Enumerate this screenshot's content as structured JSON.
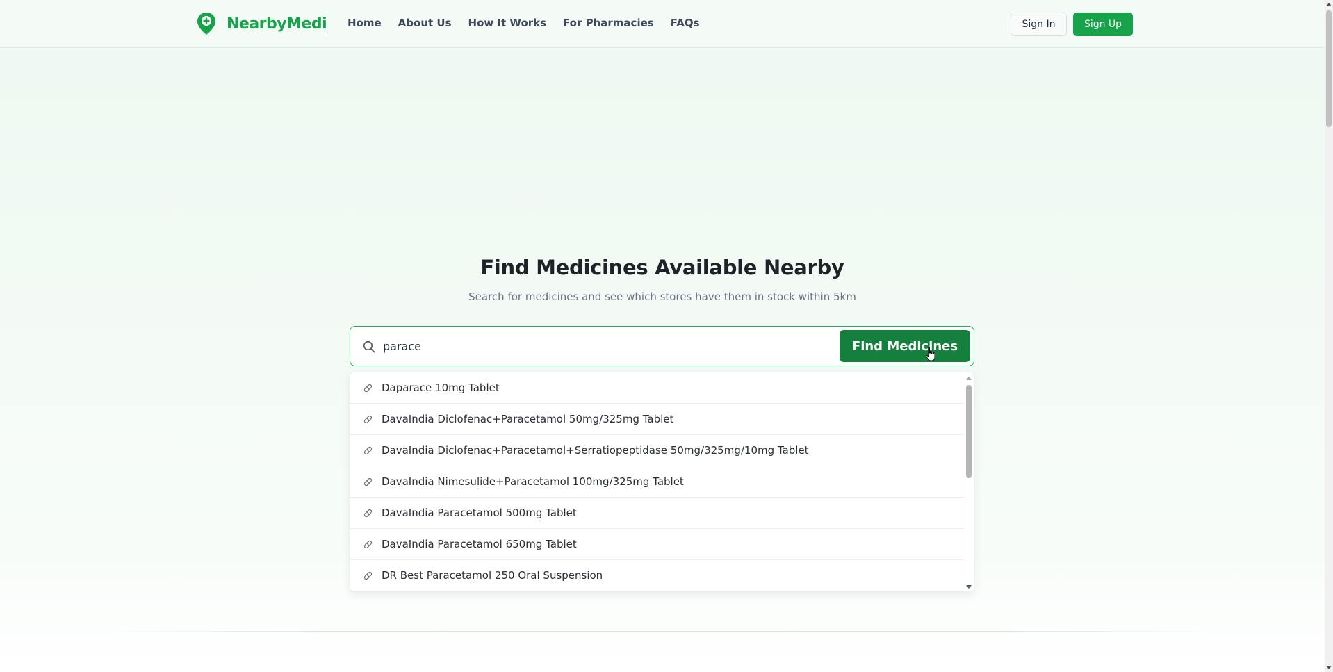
{
  "header": {
    "brand": "NearbyMedi",
    "nav": [
      "Home",
      "About Us",
      "How It Works",
      "For Pharmacies",
      "FAQs"
    ],
    "sign_in": "Sign In",
    "sign_up": "Sign Up"
  },
  "hero": {
    "title": "Find Medicines Available Nearby",
    "subtitle": "Search for medicines and see which stores have them in stock within 5km"
  },
  "search": {
    "value": "parace",
    "button": "Find Medicines"
  },
  "suggestions": [
    "Daparace 10mg Tablet",
    "DavaIndia Diclofenac+Paracetamol 50mg/325mg Tablet",
    "DavaIndia Diclofenac+Paracetamol+Serratiopeptidase 50mg/325mg/10mg Tablet",
    "DavaIndia Nimesulide+Paracetamol 100mg/325mg Tablet",
    "DavaIndia Paracetamol 500mg Tablet",
    "DavaIndia Paracetamol 650mg Tablet",
    "DR Best Paracetamol 250 Oral Suspension"
  ],
  "colors": {
    "brand_green": "#16a34a",
    "button_green": "#15803d",
    "search_border": "#22b357"
  },
  "icons": {
    "logo": "map-pin-plus-icon",
    "search": "search-icon",
    "suggestion": "pill-icon"
  }
}
